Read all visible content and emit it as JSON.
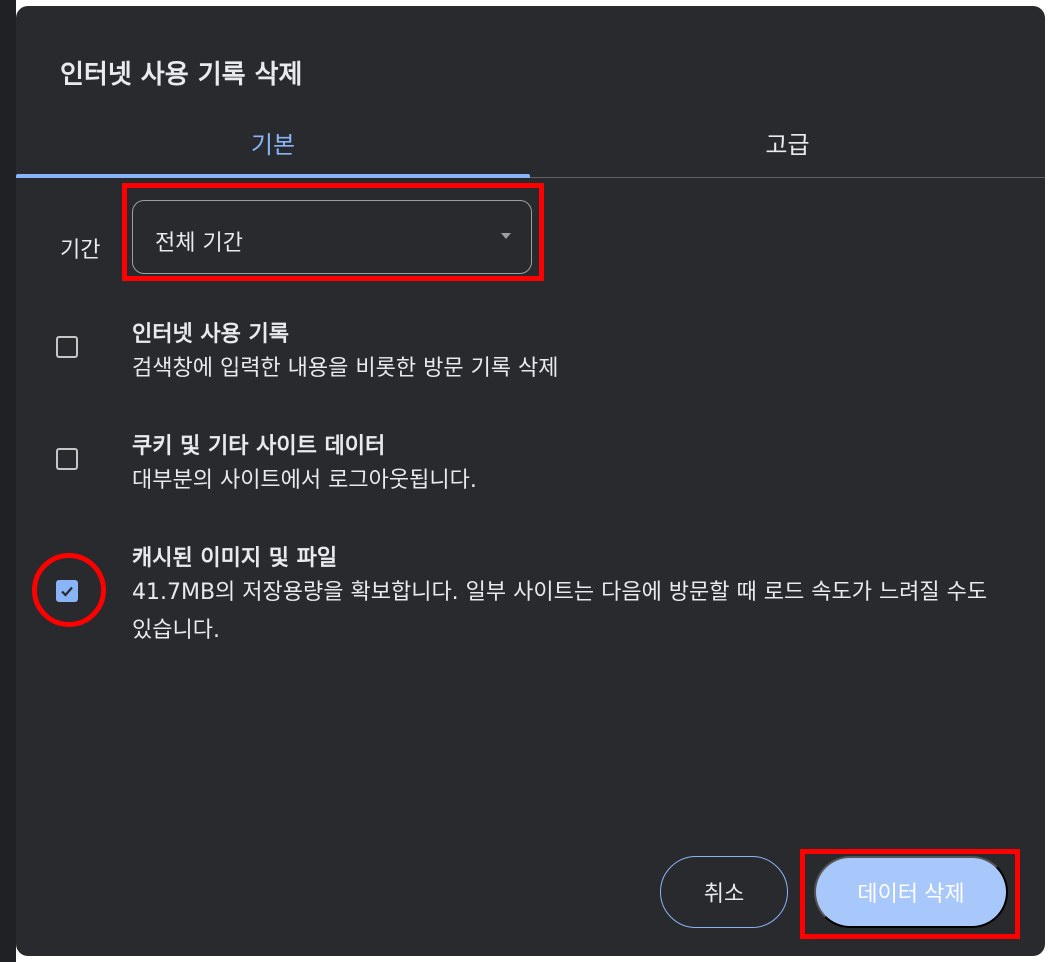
{
  "dialog": {
    "title": "인터넷 사용 기록 삭제",
    "tabs": [
      {
        "label": "기본",
        "active": true
      },
      {
        "label": "고급",
        "active": false
      }
    ],
    "time_range": {
      "label": "기간",
      "selected": "전체 기간"
    },
    "options": [
      {
        "title": "인터넷 사용 기록",
        "description": "검색창에 입력한 내용을 비롯한 방문 기록 삭제",
        "checked": false
      },
      {
        "title": "쿠키 및 기타 사이트 데이터",
        "description": "대부분의 사이트에서 로그아웃됩니다.",
        "checked": false
      },
      {
        "title": "캐시된 이미지 및 파일",
        "description": "41.7MB의 저장용량을 확보합니다. 일부 사이트는 다음에 방문할 때 로드 속도가 느려질 수도 있습니다.",
        "checked": true
      }
    ],
    "buttons": {
      "cancel": "취소",
      "delete": "데이터 삭제"
    }
  },
  "colors": {
    "dialog_bg": "#292a2d",
    "accent": "#8ab4f8",
    "primary_button": "#a8c7fa",
    "annotation": "#ff0000"
  }
}
